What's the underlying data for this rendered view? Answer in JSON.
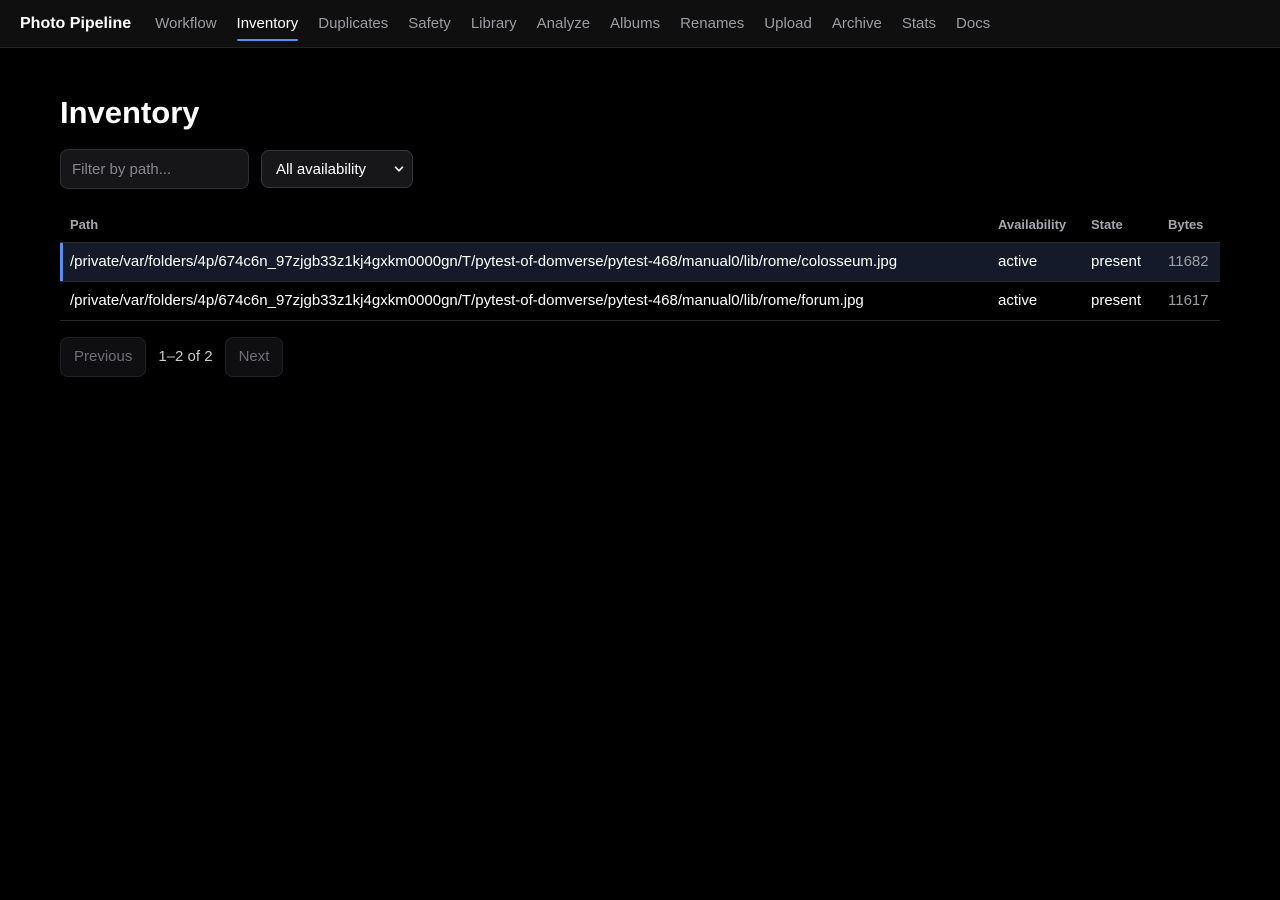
{
  "app": {
    "brand": "Photo Pipeline"
  },
  "nav": {
    "items": [
      {
        "label": "Workflow"
      },
      {
        "label": "Inventory",
        "active": true
      },
      {
        "label": "Duplicates"
      },
      {
        "label": "Safety"
      },
      {
        "label": "Library"
      },
      {
        "label": "Analyze"
      },
      {
        "label": "Albums"
      },
      {
        "label": "Renames"
      },
      {
        "label": "Upload"
      },
      {
        "label": "Archive"
      },
      {
        "label": "Stats"
      },
      {
        "label": "Docs"
      }
    ]
  },
  "page": {
    "title": "Inventory"
  },
  "filters": {
    "path_value": "",
    "path_placeholder": "Filter by path...",
    "availability_selected": "All availability"
  },
  "table": {
    "headers": {
      "path": "Path",
      "availability": "Availability",
      "state": "State",
      "bytes": "Bytes"
    },
    "rows": [
      {
        "path": "/private/var/folders/4p/674c6n_97zjgb33z1kj4gxkm0000gn/T/pytest-of-domverse/pytest-468/manual0/lib/rome/colosseum.jpg",
        "availability": "active",
        "state": "present",
        "bytes": "11682",
        "selected": true
      },
      {
        "path": "/private/var/folders/4p/674c6n_97zjgb33z1kj4gxkm0000gn/T/pytest-of-domverse/pytest-468/manual0/lib/rome/forum.jpg",
        "availability": "active",
        "state": "present",
        "bytes": "11617",
        "selected": false
      }
    ]
  },
  "pagination": {
    "previous_label": "Previous",
    "info": "1–2 of 2",
    "next_label": "Next"
  },
  "colors": {
    "accent": "#5b8ef0",
    "background": "#000000",
    "topbar": "#0f0f10",
    "selected_row": "#141a2a"
  }
}
